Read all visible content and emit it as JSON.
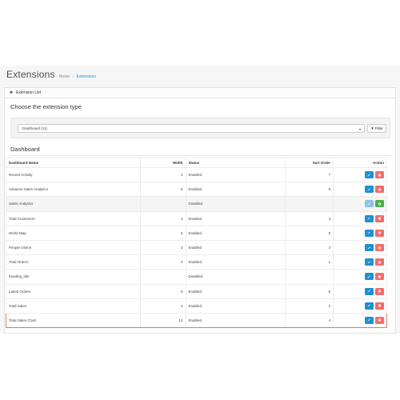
{
  "page": {
    "title": "Extensions"
  },
  "breadcrumb": {
    "home": "Home",
    "separator": "›",
    "current": "Extensions"
  },
  "panel": {
    "heading_icon": "puzzle-icon",
    "heading": "Extension List"
  },
  "chooser": {
    "title": "Choose the extension type",
    "selected": "Dashboard (11)",
    "filter_label": "Filter",
    "filter_icon": "funnel-icon"
  },
  "dashboard": {
    "heading": "Dashboard"
  },
  "table": {
    "headers": {
      "name": "Dashboard Name",
      "width": "Width",
      "status": "Status",
      "sort_order": "Sort Order",
      "action": "Action"
    },
    "rows": [
      {
        "name": "Recent Activity",
        "width": "4",
        "status": "Enabled",
        "sort_order": "7",
        "installed": true
      },
      {
        "name": "Advance Sales Analytics",
        "width": "6",
        "status": "Enabled",
        "sort_order": "6",
        "installed": true
      },
      {
        "name": "Sales Analytics",
        "width": "",
        "status": "Disabled",
        "sort_order": "",
        "installed": false
      },
      {
        "name": "Total Customers",
        "width": "3",
        "status": "Enabled",
        "sort_order": "3",
        "installed": true
      },
      {
        "name": "World Map",
        "width": "6",
        "status": "Enabled",
        "sort_order": "5",
        "installed": true
      },
      {
        "name": "People Online",
        "width": "3",
        "status": "Enabled",
        "sort_order": "4",
        "installed": true
      },
      {
        "name": "Total Orders",
        "width": "3",
        "status": "Enabled",
        "sort_order": "1",
        "installed": true
      },
      {
        "name": "heading_title",
        "width": "",
        "status": "Disabled",
        "sort_order": "",
        "installed": true
      },
      {
        "name": "Latest Orders",
        "width": "8",
        "status": "Enabled",
        "sort_order": "8",
        "installed": true
      },
      {
        "name": "Total Sales",
        "width": "3",
        "status": "Enabled",
        "sort_order": "2",
        "installed": true
      },
      {
        "name": "Total Sales Chart",
        "width": "12",
        "status": "Enabled",
        "sort_order": "4",
        "installed": true
      }
    ]
  },
  "colors": {
    "primary": "#1e91cf",
    "danger": "#f56b6b",
    "success": "#4cae4c",
    "highlight": "#e07a5f"
  }
}
